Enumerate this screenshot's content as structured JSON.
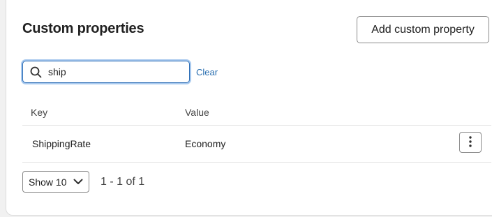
{
  "section": {
    "title": "Custom properties",
    "add_button_label": "Add custom property"
  },
  "search": {
    "value": "ship",
    "clear_label": "Clear"
  },
  "table": {
    "columns": [
      "Key",
      "Value"
    ],
    "rows": [
      {
        "key": "ShippingRate",
        "value": "Economy"
      }
    ]
  },
  "pagination": {
    "page_size_label": "Show 10",
    "range_text": "1 - 1 of 1"
  },
  "colors": {
    "focus_border": "#2f6fb7",
    "link": "#2a6fb0"
  },
  "icons": {
    "search": "search-icon",
    "row_menu": "more-vertical-icon",
    "select_arrow": "chevron-down-icon"
  }
}
